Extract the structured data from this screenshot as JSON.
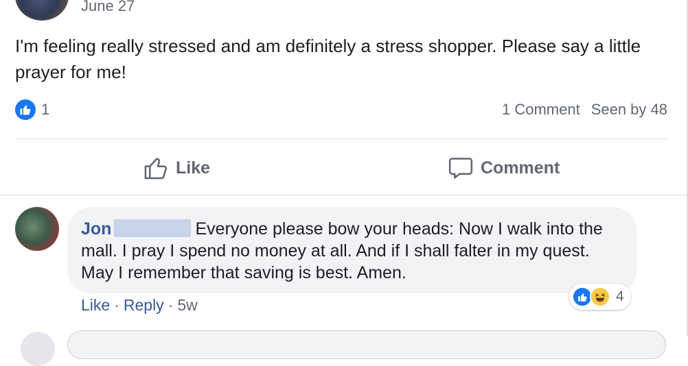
{
  "post": {
    "date": "June 27",
    "text": "I'm feeling really stressed and am definitely a stress shopper. Please say a little prayer for me!",
    "like_count": "1",
    "comment_count_text": "1 Comment",
    "seen_by_text": "Seen by 48"
  },
  "actions": {
    "like_label": "Like",
    "comment_label": "Comment"
  },
  "comment": {
    "author": "Jon",
    "text": "Everyone please bow your heads: Now I walk into the mall. I pray I spend no money at all. And if I shall falter in my quest. May I remember that saving is best. Amen.",
    "reaction_count": "4",
    "like_label": "Like",
    "reply_label": "Reply",
    "separator": "·",
    "time": "5w"
  },
  "colors": {
    "facebook_blue": "#1877f2",
    "link_blue": "#385898",
    "muted_text": "#616770",
    "bubble_bg": "#f2f3f5",
    "haha_yellow": "#f7c948"
  },
  "icons": {
    "like_badge": "thumbs-up-icon",
    "like_action": "thumbs-up-outline-icon",
    "comment_action": "speech-bubble-icon",
    "haha_reaction": "laughing-face-icon"
  }
}
